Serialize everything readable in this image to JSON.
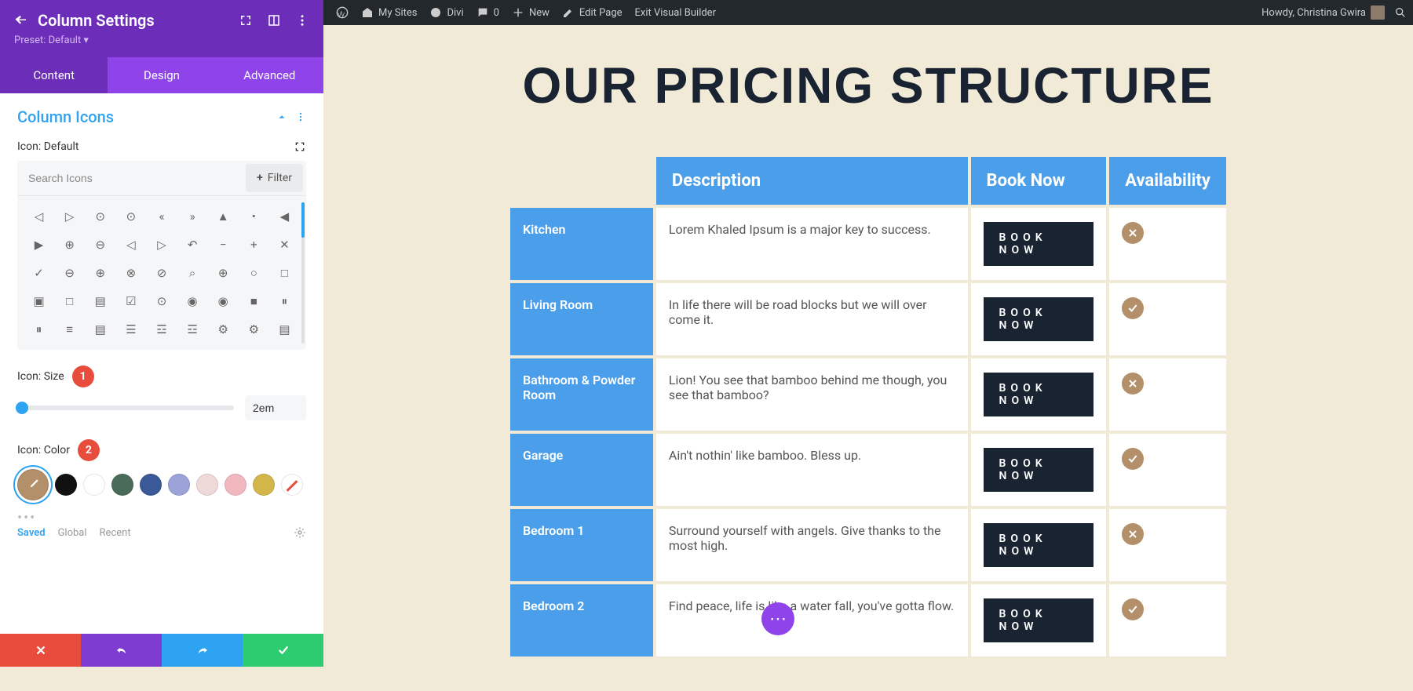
{
  "admin_bar": {
    "my_sites": "My Sites",
    "divi": "Divi",
    "comments": "0",
    "new": "New",
    "edit_page": "Edit Page",
    "exit_builder": "Exit Visual Builder",
    "greeting": "Howdy, Christina Gwira"
  },
  "panel": {
    "title": "Column Settings",
    "preset": "Preset: Default ▾",
    "tabs": {
      "content": "Content",
      "design": "Design",
      "advanced": "Advanced"
    },
    "section_title": "Column Icons",
    "icon_default_label": "Icon: Default",
    "search_placeholder": "Search Icons",
    "filter_label": "Filter",
    "icon_glyphs": [
      "◁",
      "▷",
      "⊙",
      "⊙",
      "«",
      "»",
      "▲",
      "•",
      "◀",
      "▶",
      "⊕",
      "⊖",
      "◁",
      "▷",
      "↶",
      "−",
      "+",
      "✕",
      "✓",
      "⊖",
      "⊕",
      "⊗",
      "⊘",
      "⌕",
      "⊕",
      "○",
      "□",
      "▣",
      "□",
      "▤",
      "☑",
      "⊙",
      "◉",
      "◉",
      "■",
      "⏸",
      "⏸",
      "≡",
      "▤",
      "☰",
      "☲",
      "☲",
      "⚙",
      "⚙",
      "▤"
    ],
    "size_label": "Icon: Size",
    "size_value": "2em",
    "color_label": "Icon: Color",
    "swatches": [
      "#b38f6a",
      "#111111",
      "#ffffff",
      "#4a6b5a",
      "#3b5998",
      "#9ba3d8",
      "#f0d9d9",
      "#f2b8c0",
      "#d4b74a"
    ],
    "color_tabs": {
      "saved": "Saved",
      "global": "Global",
      "recent": "Recent"
    },
    "badge1": "1",
    "badge2": "2"
  },
  "page": {
    "heading": "OUR PRICING STRUCTURE",
    "headers": {
      "desc": "Description",
      "book": "Book Now",
      "avail": "Availability"
    },
    "book_label": "BOOK NOW",
    "rows": [
      {
        "name": "Kitchen",
        "desc": "Lorem Khaled Ipsum is a major key to success.",
        "available": false
      },
      {
        "name": "Living Room",
        "desc": "In life there will be road blocks but we will over come it.",
        "available": true
      },
      {
        "name": "Bathroom & Powder Room",
        "desc": "Lion! You see that bamboo behind me though, you see that bamboo?",
        "available": false
      },
      {
        "name": "Garage",
        "desc": "Ain't nothin' like bamboo. Bless up.",
        "available": true
      },
      {
        "name": "Bedroom 1",
        "desc": "Surround yourself with angels. Give thanks to the most high.",
        "available": false
      },
      {
        "name": "Bedroom 2",
        "desc": "Find peace, life is like a water fall, you've gotta flow.",
        "available": true
      }
    ]
  }
}
